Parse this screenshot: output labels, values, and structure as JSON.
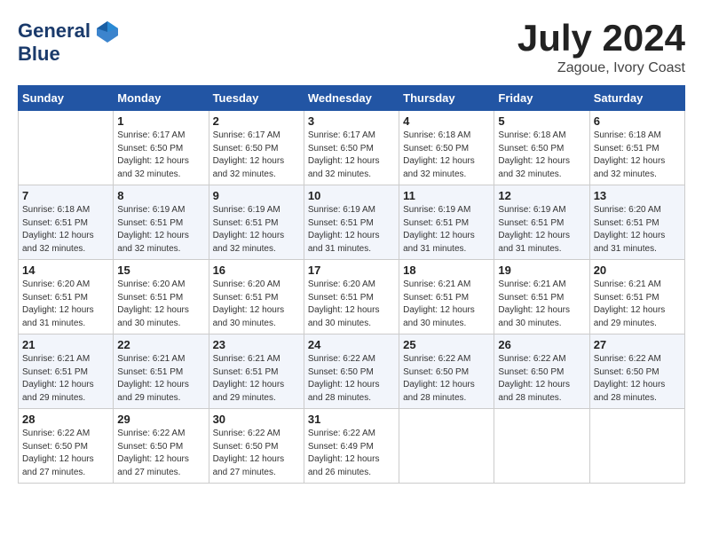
{
  "header": {
    "logo_line1": "General",
    "logo_line2": "Blue",
    "month_title": "July 2024",
    "location": "Zagoue, Ivory Coast"
  },
  "days_of_week": [
    "Sunday",
    "Monday",
    "Tuesday",
    "Wednesday",
    "Thursday",
    "Friday",
    "Saturday"
  ],
  "weeks": [
    [
      {
        "day": "",
        "sunrise": "",
        "sunset": "",
        "daylight": ""
      },
      {
        "day": "1",
        "sunrise": "Sunrise: 6:17 AM",
        "sunset": "Sunset: 6:50 PM",
        "daylight": "Daylight: 12 hours and 32 minutes."
      },
      {
        "day": "2",
        "sunrise": "Sunrise: 6:17 AM",
        "sunset": "Sunset: 6:50 PM",
        "daylight": "Daylight: 12 hours and 32 minutes."
      },
      {
        "day": "3",
        "sunrise": "Sunrise: 6:17 AM",
        "sunset": "Sunset: 6:50 PM",
        "daylight": "Daylight: 12 hours and 32 minutes."
      },
      {
        "day": "4",
        "sunrise": "Sunrise: 6:18 AM",
        "sunset": "Sunset: 6:50 PM",
        "daylight": "Daylight: 12 hours and 32 minutes."
      },
      {
        "day": "5",
        "sunrise": "Sunrise: 6:18 AM",
        "sunset": "Sunset: 6:50 PM",
        "daylight": "Daylight: 12 hours and 32 minutes."
      },
      {
        "day": "6",
        "sunrise": "Sunrise: 6:18 AM",
        "sunset": "Sunset: 6:51 PM",
        "daylight": "Daylight: 12 hours and 32 minutes."
      }
    ],
    [
      {
        "day": "7",
        "sunrise": "Sunrise: 6:18 AM",
        "sunset": "Sunset: 6:51 PM",
        "daylight": "Daylight: 12 hours and 32 minutes."
      },
      {
        "day": "8",
        "sunrise": "Sunrise: 6:19 AM",
        "sunset": "Sunset: 6:51 PM",
        "daylight": "Daylight: 12 hours and 32 minutes."
      },
      {
        "day": "9",
        "sunrise": "Sunrise: 6:19 AM",
        "sunset": "Sunset: 6:51 PM",
        "daylight": "Daylight: 12 hours and 32 minutes."
      },
      {
        "day": "10",
        "sunrise": "Sunrise: 6:19 AM",
        "sunset": "Sunset: 6:51 PM",
        "daylight": "Daylight: 12 hours and 31 minutes."
      },
      {
        "day": "11",
        "sunrise": "Sunrise: 6:19 AM",
        "sunset": "Sunset: 6:51 PM",
        "daylight": "Daylight: 12 hours and 31 minutes."
      },
      {
        "day": "12",
        "sunrise": "Sunrise: 6:19 AM",
        "sunset": "Sunset: 6:51 PM",
        "daylight": "Daylight: 12 hours and 31 minutes."
      },
      {
        "day": "13",
        "sunrise": "Sunrise: 6:20 AM",
        "sunset": "Sunset: 6:51 PM",
        "daylight": "Daylight: 12 hours and 31 minutes."
      }
    ],
    [
      {
        "day": "14",
        "sunrise": "Sunrise: 6:20 AM",
        "sunset": "Sunset: 6:51 PM",
        "daylight": "Daylight: 12 hours and 31 minutes."
      },
      {
        "day": "15",
        "sunrise": "Sunrise: 6:20 AM",
        "sunset": "Sunset: 6:51 PM",
        "daylight": "Daylight: 12 hours and 30 minutes."
      },
      {
        "day": "16",
        "sunrise": "Sunrise: 6:20 AM",
        "sunset": "Sunset: 6:51 PM",
        "daylight": "Daylight: 12 hours and 30 minutes."
      },
      {
        "day": "17",
        "sunrise": "Sunrise: 6:20 AM",
        "sunset": "Sunset: 6:51 PM",
        "daylight": "Daylight: 12 hours and 30 minutes."
      },
      {
        "day": "18",
        "sunrise": "Sunrise: 6:21 AM",
        "sunset": "Sunset: 6:51 PM",
        "daylight": "Daylight: 12 hours and 30 minutes."
      },
      {
        "day": "19",
        "sunrise": "Sunrise: 6:21 AM",
        "sunset": "Sunset: 6:51 PM",
        "daylight": "Daylight: 12 hours and 30 minutes."
      },
      {
        "day": "20",
        "sunrise": "Sunrise: 6:21 AM",
        "sunset": "Sunset: 6:51 PM",
        "daylight": "Daylight: 12 hours and 29 minutes."
      }
    ],
    [
      {
        "day": "21",
        "sunrise": "Sunrise: 6:21 AM",
        "sunset": "Sunset: 6:51 PM",
        "daylight": "Daylight: 12 hours and 29 minutes."
      },
      {
        "day": "22",
        "sunrise": "Sunrise: 6:21 AM",
        "sunset": "Sunset: 6:51 PM",
        "daylight": "Daylight: 12 hours and 29 minutes."
      },
      {
        "day": "23",
        "sunrise": "Sunrise: 6:21 AM",
        "sunset": "Sunset: 6:51 PM",
        "daylight": "Daylight: 12 hours and 29 minutes."
      },
      {
        "day": "24",
        "sunrise": "Sunrise: 6:22 AM",
        "sunset": "Sunset: 6:50 PM",
        "daylight": "Daylight: 12 hours and 28 minutes."
      },
      {
        "day": "25",
        "sunrise": "Sunrise: 6:22 AM",
        "sunset": "Sunset: 6:50 PM",
        "daylight": "Daylight: 12 hours and 28 minutes."
      },
      {
        "day": "26",
        "sunrise": "Sunrise: 6:22 AM",
        "sunset": "Sunset: 6:50 PM",
        "daylight": "Daylight: 12 hours and 28 minutes."
      },
      {
        "day": "27",
        "sunrise": "Sunrise: 6:22 AM",
        "sunset": "Sunset: 6:50 PM",
        "daylight": "Daylight: 12 hours and 28 minutes."
      }
    ],
    [
      {
        "day": "28",
        "sunrise": "Sunrise: 6:22 AM",
        "sunset": "Sunset: 6:50 PM",
        "daylight": "Daylight: 12 hours and 27 minutes."
      },
      {
        "day": "29",
        "sunrise": "Sunrise: 6:22 AM",
        "sunset": "Sunset: 6:50 PM",
        "daylight": "Daylight: 12 hours and 27 minutes."
      },
      {
        "day": "30",
        "sunrise": "Sunrise: 6:22 AM",
        "sunset": "Sunset: 6:50 PM",
        "daylight": "Daylight: 12 hours and 27 minutes."
      },
      {
        "day": "31",
        "sunrise": "Sunrise: 6:22 AM",
        "sunset": "Sunset: 6:49 PM",
        "daylight": "Daylight: 12 hours and 26 minutes."
      },
      {
        "day": "",
        "sunrise": "",
        "sunset": "",
        "daylight": ""
      },
      {
        "day": "",
        "sunrise": "",
        "sunset": "",
        "daylight": ""
      },
      {
        "day": "",
        "sunrise": "",
        "sunset": "",
        "daylight": ""
      }
    ]
  ]
}
